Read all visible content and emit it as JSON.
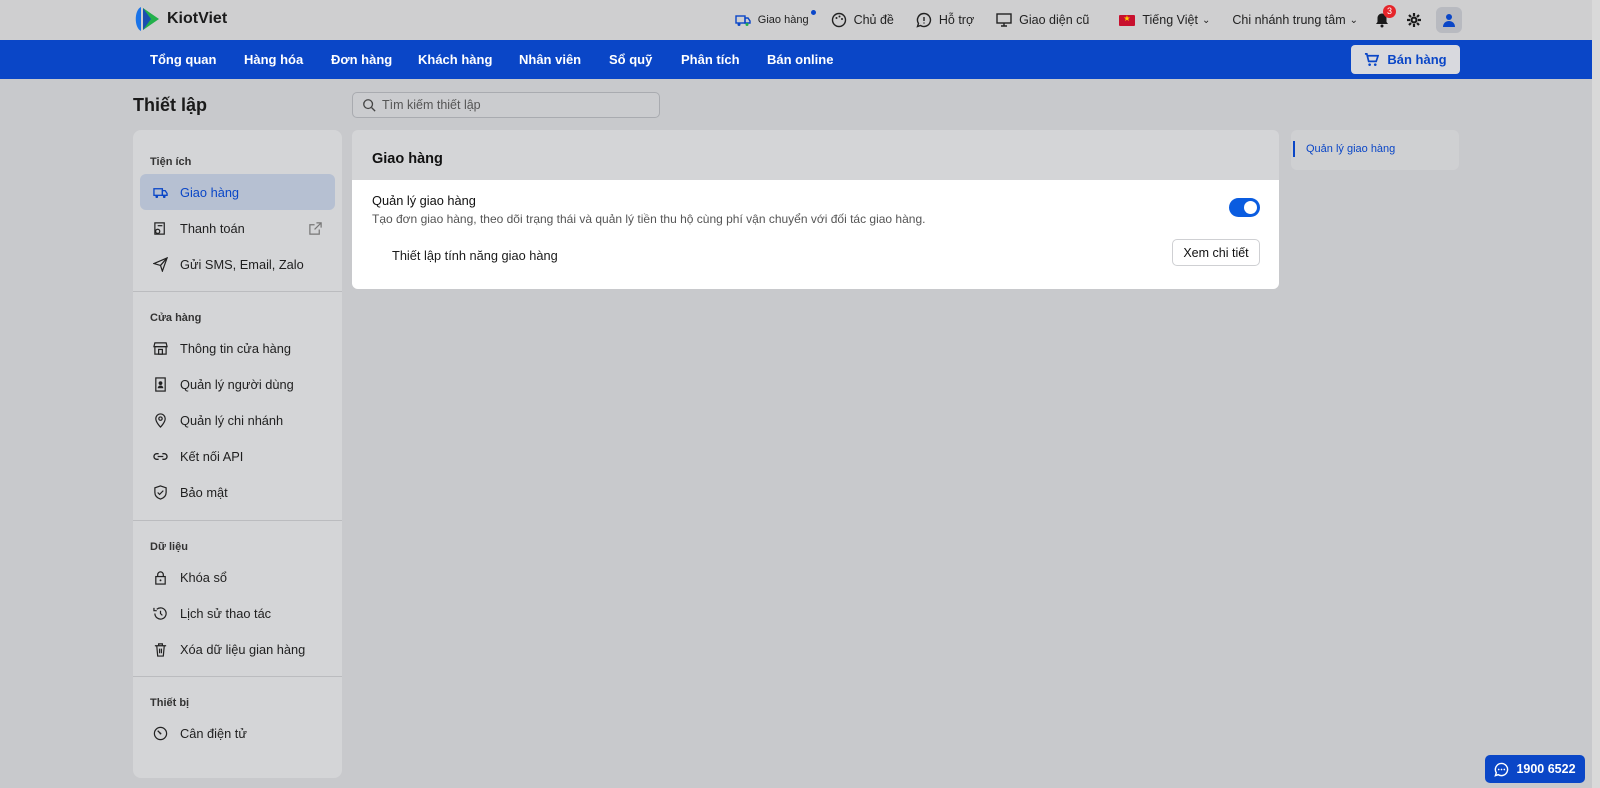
{
  "app": {
    "name": "KiotViet"
  },
  "topbar": {
    "delivery": "Giao hàng",
    "theme": "Chủ đề",
    "support": "Hỗ trợ",
    "old_ui": "Giao diện cũ",
    "language": "Tiếng Việt",
    "branch": "Chi nhánh trung tâm",
    "notification_count": "3"
  },
  "nav": {
    "items": [
      "Tổng quan",
      "Hàng hóa",
      "Đơn hàng",
      "Khách hàng",
      "Nhân viên",
      "Sổ quỹ",
      "Phân tích",
      "Bán online"
    ],
    "sell_button": "Bán hàng"
  },
  "page": {
    "title": "Thiết lập",
    "search_placeholder": "Tìm kiếm thiết lập"
  },
  "sidebar": {
    "sections": [
      {
        "title": "Tiện ích",
        "items": [
          "Giao hàng",
          "Thanh toán",
          "Gửi SMS, Email, Zalo"
        ]
      },
      {
        "title": "Cửa hàng",
        "items": [
          "Thông tin cửa hàng",
          "Quản lý người dùng",
          "Quản lý chi nhánh",
          "Kết nối API",
          "Bảo mật"
        ]
      },
      {
        "title": "Dữ liệu",
        "items": [
          "Khóa sổ",
          "Lịch sử thao tác",
          "Xóa dữ liệu gian hàng"
        ]
      },
      {
        "title": "Thiết bị",
        "items": [
          "Cân điện tử"
        ]
      }
    ],
    "active_item": "Giao hàng"
  },
  "panel": {
    "title": "Giao hàng",
    "feature_title": "Quản lý giao hàng",
    "feature_desc": "Tạo đơn giao hàng, theo dõi trạng thái và quản lý tiền thu hộ cùng phí vận chuyển với đối tác giao hàng.",
    "toggle_on": true,
    "sub_title": "Thiết lập tính năng giao hàng",
    "detail_button": "Xem chi tiết"
  },
  "toc": {
    "link": "Quản lý giao hàng"
  },
  "hotline": "1900 6522",
  "colors": {
    "brand": "#0a46c7",
    "toggle": "#0a5ce0",
    "badge": "#e5252a"
  }
}
